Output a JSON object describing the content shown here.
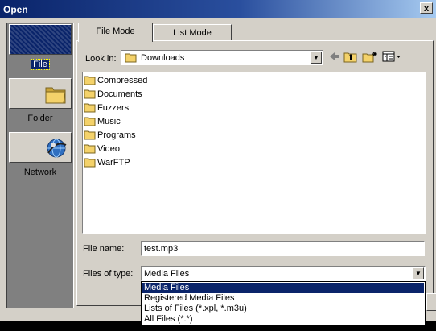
{
  "window": {
    "title": "Open",
    "close_glyph": "x"
  },
  "places": [
    {
      "label": "File",
      "icon": "file-icon",
      "selected": true
    },
    {
      "label": "Folder",
      "icon": "folder-icon",
      "selected": false
    },
    {
      "label": "Network",
      "icon": "globe-icon",
      "selected": false
    }
  ],
  "tabs": [
    {
      "label": "File Mode",
      "active": true
    },
    {
      "label": "List Mode",
      "active": false
    }
  ],
  "lookin": {
    "label": "Look in:",
    "value": "Downloads",
    "icon": "folder-icon",
    "toolbar": [
      "back-arrow-icon",
      "up-folder-icon",
      "new-folder-icon",
      "view-menu-icon"
    ]
  },
  "files": [
    {
      "name": "Compressed",
      "icon": "folder-icon"
    },
    {
      "name": "Documents",
      "icon": "folder-icon"
    },
    {
      "name": "Fuzzers",
      "icon": "folder-icon"
    },
    {
      "name": "Music",
      "icon": "folder-icon"
    },
    {
      "name": "Programs",
      "icon": "folder-icon"
    },
    {
      "name": "Video",
      "icon": "folder-icon"
    },
    {
      "name": "WarFTP",
      "icon": "folder-icon"
    }
  ],
  "filename": {
    "label": "File name:",
    "value": "test.mp3"
  },
  "filetype": {
    "label": "Files of type:",
    "value": "Media Files",
    "options": [
      {
        "label": "Media Files",
        "selected": true
      },
      {
        "label": "Registered Media Files",
        "selected": false
      },
      {
        "label": "Lists of Files (*.xpl, *.m3u)",
        "selected": false
      },
      {
        "label": "All Files (*.*)",
        "selected": false
      }
    ]
  },
  "colors": {
    "face": "#d4d0c8",
    "selection": "#0a246a",
    "title_start": "#0a246a",
    "title_end": "#a6caf0",
    "folder": "#f4d26a"
  }
}
